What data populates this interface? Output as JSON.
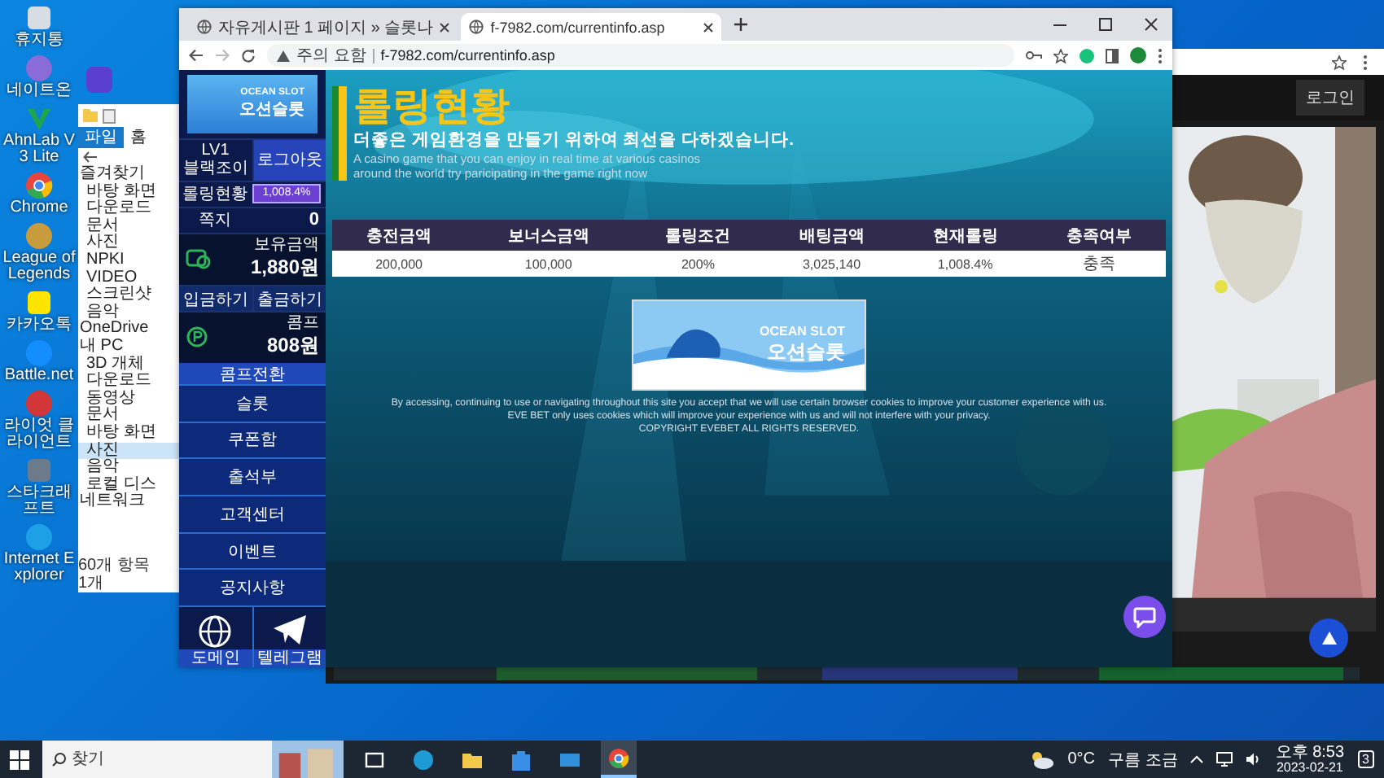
{
  "desktop_icons": [
    {
      "kind": "trash",
      "label": "휴지통"
    },
    {
      "kind": "nateon",
      "label": "네이트온"
    },
    {
      "kind": "v3",
      "label": "AhnLab V3 Lite"
    },
    {
      "kind": "chrome",
      "label": "Chrome"
    },
    {
      "kind": "lol",
      "label": "League of Legends"
    },
    {
      "kind": "kakao",
      "label": "카카오톡"
    },
    {
      "kind": "battlenet",
      "label": "Battle.net"
    },
    {
      "kind": "riot",
      "label": "라이엇 클라이언트"
    },
    {
      "kind": "starcraft",
      "label": "스타크래프트"
    },
    {
      "kind": "ie",
      "label": "Internet Explorer"
    }
  ],
  "explorer": {
    "tabs": [
      {
        "label": "파일",
        "selected": true
      },
      {
        "label": "홈",
        "selected": false
      }
    ],
    "tree": [
      {
        "label": "즐겨찾기",
        "selected": false,
        "children": [
          {
            "label": "바탕 화면",
            "selected": false
          },
          {
            "label": "다운로드",
            "selected": false
          },
          {
            "label": "문서",
            "selected": false
          },
          {
            "label": "사진",
            "selected": false
          },
          {
            "label": "NPKI",
            "selected": false
          },
          {
            "label": "VIDEO",
            "selected": false
          },
          {
            "label": "스크린샷",
            "selected": false
          },
          {
            "label": "음악",
            "selected": false
          }
        ]
      },
      {
        "label": "OneDrive",
        "selected": false
      },
      {
        "label": "내 PC",
        "selected": false,
        "children": [
          {
            "label": "3D 개체",
            "selected": false
          },
          {
            "label": "다운로드",
            "selected": false
          },
          {
            "label": "동영상",
            "selected": false
          },
          {
            "label": "문서",
            "selected": false
          },
          {
            "label": "바탕 화면",
            "selected": false
          },
          {
            "label": "사진",
            "selected": true
          },
          {
            "label": "음악",
            "selected": false
          },
          {
            "label": "로컬 디스",
            "selected": false
          }
        ]
      },
      {
        "label": "네트워크",
        "selected": false
      }
    ],
    "status": [
      "60개 항목",
      "1개"
    ]
  },
  "browser": {
    "tabs": [
      {
        "title": "자유게시판 1 페이지 » 슬롯나",
        "selected": false
      },
      {
        "title": "f-7982.com/currentinfo.asp",
        "selected": true
      }
    ],
    "security": "주의 요함",
    "url": "f-7982.com/currentinfo.asp"
  },
  "site": {
    "logo": {
      "en": "OCEAN SLOT",
      "ko": "오션슬롯"
    },
    "user": {
      "level": "LV1",
      "name": "블랙조이"
    },
    "logout": "로그아웃",
    "rolling": {
      "label": "롤링현황",
      "reading": "1,008.4%",
      "level": 1
    },
    "notes": {
      "label": "쪽지",
      "count": "0"
    },
    "balance": {
      "label": "보유금액",
      "amount": "1,880원"
    },
    "deposit": "입금하기",
    "withdraw": "출금하기",
    "comp": {
      "label": "콤프",
      "amount": "808원"
    },
    "comp_convert": "콤프전환",
    "menu": [
      "슬롯",
      "쿠폰함",
      "출석부",
      "고객센터",
      "이벤트",
      "공지사항"
    ],
    "links": [
      {
        "kind": "www",
        "label": "도메인"
      },
      {
        "kind": "telegram",
        "label": "텔레그램"
      }
    ]
  },
  "page": {
    "title": "롤링현황",
    "subtitle": "더좋은 게임환경을 만들기 위하여 최선을 다하겠습니다.",
    "intro": [
      "A casino game that you can enjoy in real time at various casinos",
      "around the world try paricipating in the game right now"
    ],
    "table": {
      "columns": [
        "충전금액",
        "보너스금액",
        "롤링조건",
        "배팅금액",
        "현재롤링",
        "충족여부"
      ],
      "rows": [
        [
          "200,000",
          "100,000",
          "200%",
          "3,025,140",
          "1,008.4%",
          "충족"
        ]
      ]
    },
    "banner": {
      "en": "OCEAN SLOT",
      "ko": "오션슬롯"
    },
    "footer": [
      "By accessing, continuing to use or navigating throughout this site you accept that we will use certain browser cookies to improve your customer experience with us.",
      "EVE BET only uses cookies which will improve your experience with us and will not interfere with your privacy.",
      "COPYRIGHT EVEBET ALL RIGHTS RESERVED."
    ]
  },
  "second_window": {
    "login": "로그인"
  },
  "taskbar": {
    "search": {
      "placeholder": "찾기"
    },
    "apps": [
      {
        "kind": "taskview",
        "selected": false
      },
      {
        "kind": "edge",
        "selected": false
      },
      {
        "kind": "explorer",
        "selected": false
      },
      {
        "kind": "store",
        "selected": false
      },
      {
        "kind": "mail",
        "selected": false
      },
      {
        "kind": "chrome",
        "selected": true
      }
    ],
    "weather": {
      "temp": "0°C",
      "text": "구름 조금"
    },
    "time": "오후 8:53",
    "date": "2023-02-21",
    "notifications": "3"
  }
}
